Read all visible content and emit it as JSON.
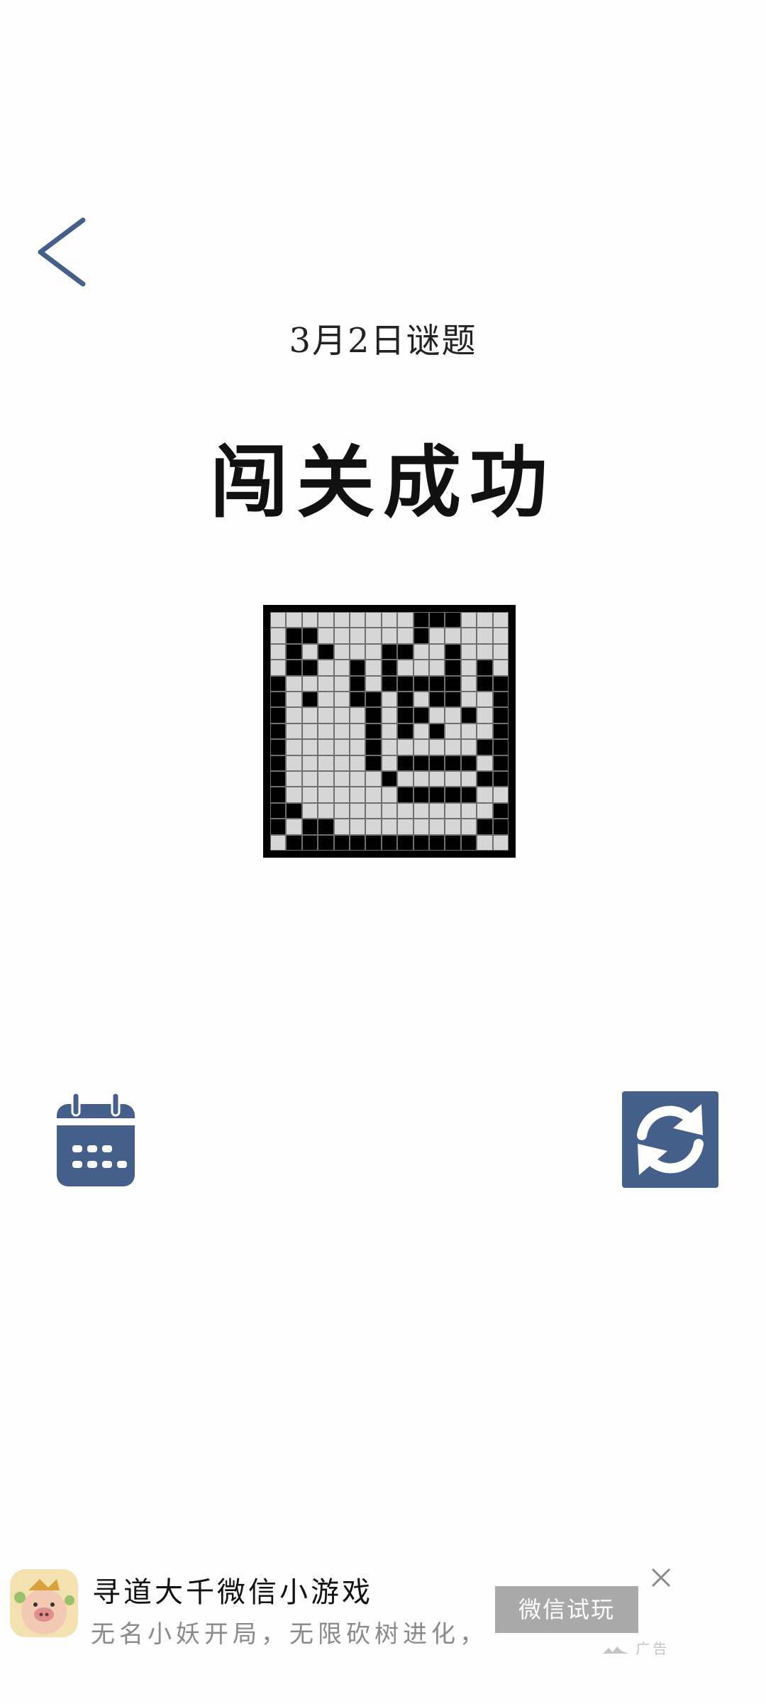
{
  "header": {
    "date_title": "3月2日谜题",
    "result_title": "闯关成功"
  },
  "puzzle": {
    "rows": 15,
    "cols": 15,
    "cells": [
      "000000000111000",
      "011000000100000",
      "010100011001000",
      "011001010001010",
      "100001011111011",
      "101001101011001",
      "100000101100101",
      "100000101010001",
      "100000100000011",
      "100000101111101",
      "100000010000011",
      "100000001111100",
      "110000000000001",
      "101100000000011",
      "011111111111100"
    ]
  },
  "controls": {
    "calendar_icon": "calendar-icon",
    "refresh_icon": "refresh-icon",
    "back_icon": "chevron-left-icon",
    "accent": "#44608a"
  },
  "ad": {
    "title": "寻道大千微信小游戏",
    "description": "无名小妖开局，无限砍树进化，",
    "ellipsis": "...",
    "cta": "微信试玩",
    "label": "广告"
  }
}
